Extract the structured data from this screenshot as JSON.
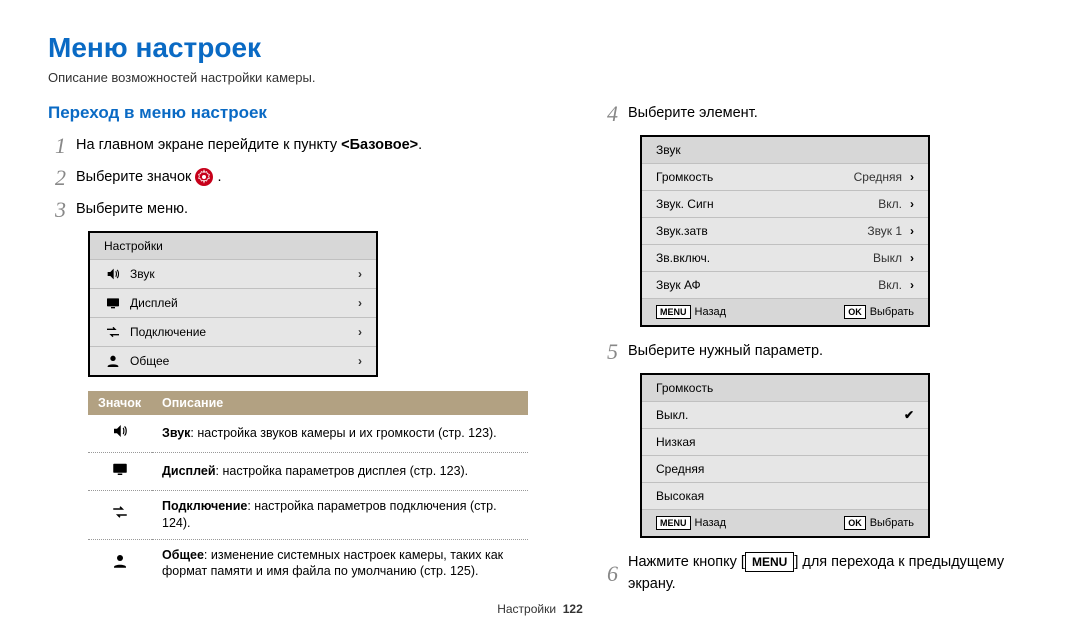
{
  "page": {
    "title": "Меню настроек",
    "description": "Описание возможностей настройки камеры."
  },
  "left": {
    "section_title": "Переход в меню настроек",
    "step1_prefix": "На главном экране перейдите к пункту ",
    "step1_bold": "<Базовое>",
    "step1_suffix": ".",
    "step2_prefix": "Выберите значок ",
    "step2_suffix": ".",
    "step3": "Выберите меню.",
    "settings_menu": {
      "title": "Настройки",
      "items": [
        {
          "label": "Звук"
        },
        {
          "label": "Дисплей"
        },
        {
          "label": "Подключение"
        },
        {
          "label": "Общее"
        }
      ]
    },
    "table": {
      "h1": "Значок",
      "h2": "Описание",
      "rows": [
        {
          "bold": "Звук",
          "text": ": настройка звуков камеры и их громкости (стр. 123)."
        },
        {
          "bold": "Дисплей",
          "text": ": настройка параметров дисплея (стр. 123)."
        },
        {
          "bold": "Подключение",
          "text": ": настройка параметров подключения (стр. 124)."
        },
        {
          "bold": "Общее",
          "text": ": изменение системных настроек камеры, таких как формат памяти и имя файла по умолчанию (стр. 125)."
        }
      ]
    }
  },
  "right": {
    "step4": "Выберите элемент.",
    "sound_menu": {
      "title": "Звук",
      "rows": [
        {
          "l": "Громкость",
          "r": "Средняя"
        },
        {
          "l": "Звук. Сигн",
          "r": "Вкл."
        },
        {
          "l": "Звук.затв",
          "r": "Звук 1"
        },
        {
          "l": "Зв.включ.",
          "r": "Выкл"
        },
        {
          "l": "Звук АФ",
          "r": "Вкл."
        }
      ],
      "footer": {
        "back": "Назад",
        "select": "Выбрать",
        "menu_badge": "MENU",
        "ok_badge": "OK"
      }
    },
    "step5": "Выберите нужный параметр.",
    "volume_menu": {
      "title": "Громкость",
      "rows": [
        "Выкл.",
        "Низкая",
        "Средняя",
        "Высокая"
      ],
      "selected_index": 0,
      "footer": {
        "back": "Назад",
        "select": "Выбрать",
        "menu_badge": "MENU",
        "ok_badge": "OK"
      }
    },
    "step6_prefix": "Нажмите кнопку [",
    "step6_key": "MENU",
    "step6_suffix": "] для перехода к предыдущему экрану."
  },
  "footer": {
    "label": "Настройки",
    "page": "122"
  }
}
